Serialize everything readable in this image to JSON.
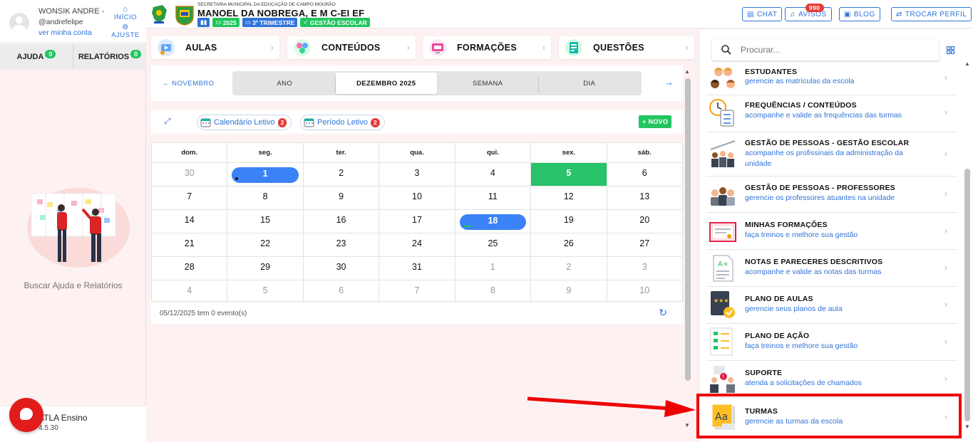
{
  "user": {
    "name": "WONSIK ANDRE -",
    "handle": "@andrefelipe",
    "profile_link": "ver minha conta",
    "inicio_label": "INÍCIO",
    "ajuste_label": "AJUSTE"
  },
  "left_tabs": [
    {
      "label": "AJUDA",
      "badge": "0"
    },
    {
      "label": "RELATÓRIOS",
      "badge": "0"
    }
  ],
  "help_text": "Buscar Ajuda e Relatórios",
  "app": {
    "name": "ATLA Ensino",
    "version": "4.5.30"
  },
  "header": {
    "secretaria": "SECRETARIA MUNICIPAL DA EDUCAÇÃO DE CAMPO MOURÃO",
    "school": "MANOEL DA NOBREGA, E M C-EI EF",
    "year": "2025",
    "term": "3º TRIMESTRE",
    "mode": "GESTÃO ESCOLAR",
    "buttons": {
      "chat": "CHAT",
      "avisos": "AVISOS",
      "avisos_badge": "990",
      "blog": "BLOG",
      "trocar": "TROCAR PERFIL"
    }
  },
  "nav": [
    {
      "label": "AULAS"
    },
    {
      "label": "CONTEÚDOS"
    },
    {
      "label": "FORMAÇÕES"
    },
    {
      "label": "QUESTÕES"
    }
  ],
  "calendar_view": {
    "prev": "NOVEMBRO",
    "tabs": [
      "ANO",
      "DEZEMBRO 2025",
      "SEMANA",
      "DIA"
    ],
    "active": "DEZEMBRO 2025"
  },
  "filters": {
    "calendario": "Calendário Letivo",
    "calendario_badge": "2",
    "periodo": "Período Letivo",
    "periodo_badge": "2",
    "novo": "NOVO"
  },
  "calendar": {
    "weekdays": [
      "dom.",
      "seg.",
      "ter.",
      "qua.",
      "qui.",
      "sex.",
      "sáb."
    ],
    "weeks": [
      [
        "30",
        "1",
        "2",
        "3",
        "4",
        "5",
        "6"
      ],
      [
        "7",
        "8",
        "9",
        "10",
        "11",
        "12",
        "13"
      ],
      [
        "14",
        "15",
        "16",
        "17",
        "18",
        "19",
        "20"
      ],
      [
        "21",
        "22",
        "23",
        "24",
        "25",
        "26",
        "27"
      ],
      [
        "28",
        "29",
        "30",
        "31",
        "1",
        "2",
        "3"
      ],
      [
        "4",
        "5",
        "6",
        "7",
        "8",
        "9",
        "10"
      ]
    ]
  },
  "events_text": "05/12/2025 tem 0 evento(s)",
  "search": {
    "placeholder": "Procurar..."
  },
  "modules": [
    {
      "title": "ESTUDANTES",
      "sub": "gerencie as matrículas da escola"
    },
    {
      "title": "FREQUÊNCIAS / CONTEÚDOS",
      "sub": "acompanhe e valide as frequências das turmas"
    },
    {
      "title": "GESTÃO DE PESSOAS - GESTÃO ESCOLAR",
      "sub": "acompanhe os profissinais da administração da unidade"
    },
    {
      "title": "GESTÃO DE PESSOAS - PROFESSORES",
      "sub": "gerencie os professores atuantes na unidade"
    },
    {
      "title": "MINHAS FORMAÇÕES",
      "sub": "faça treinos e melhore sua gestão"
    },
    {
      "title": "NOTAS E PARECERES DESCRITIVOS",
      "sub": "acompanhe e valide as notas das turmas"
    },
    {
      "title": "PLANO DE AULAS",
      "sub": "gerencie seus planos de aula"
    },
    {
      "title": "PLANO DE AÇÃO",
      "sub": "faça treinos e melhore sua gestão"
    },
    {
      "title": "SUPORTE",
      "sub": "atenda a solicitações de chamados"
    },
    {
      "title": "TURMAS",
      "sub": "gerencie as turmas da escola"
    }
  ],
  "colors": {
    "accent": "#2f73d9",
    "green": "#22c55e",
    "red": "#e53935",
    "today": "#27c26a",
    "event_pill": "#3b82f6"
  }
}
